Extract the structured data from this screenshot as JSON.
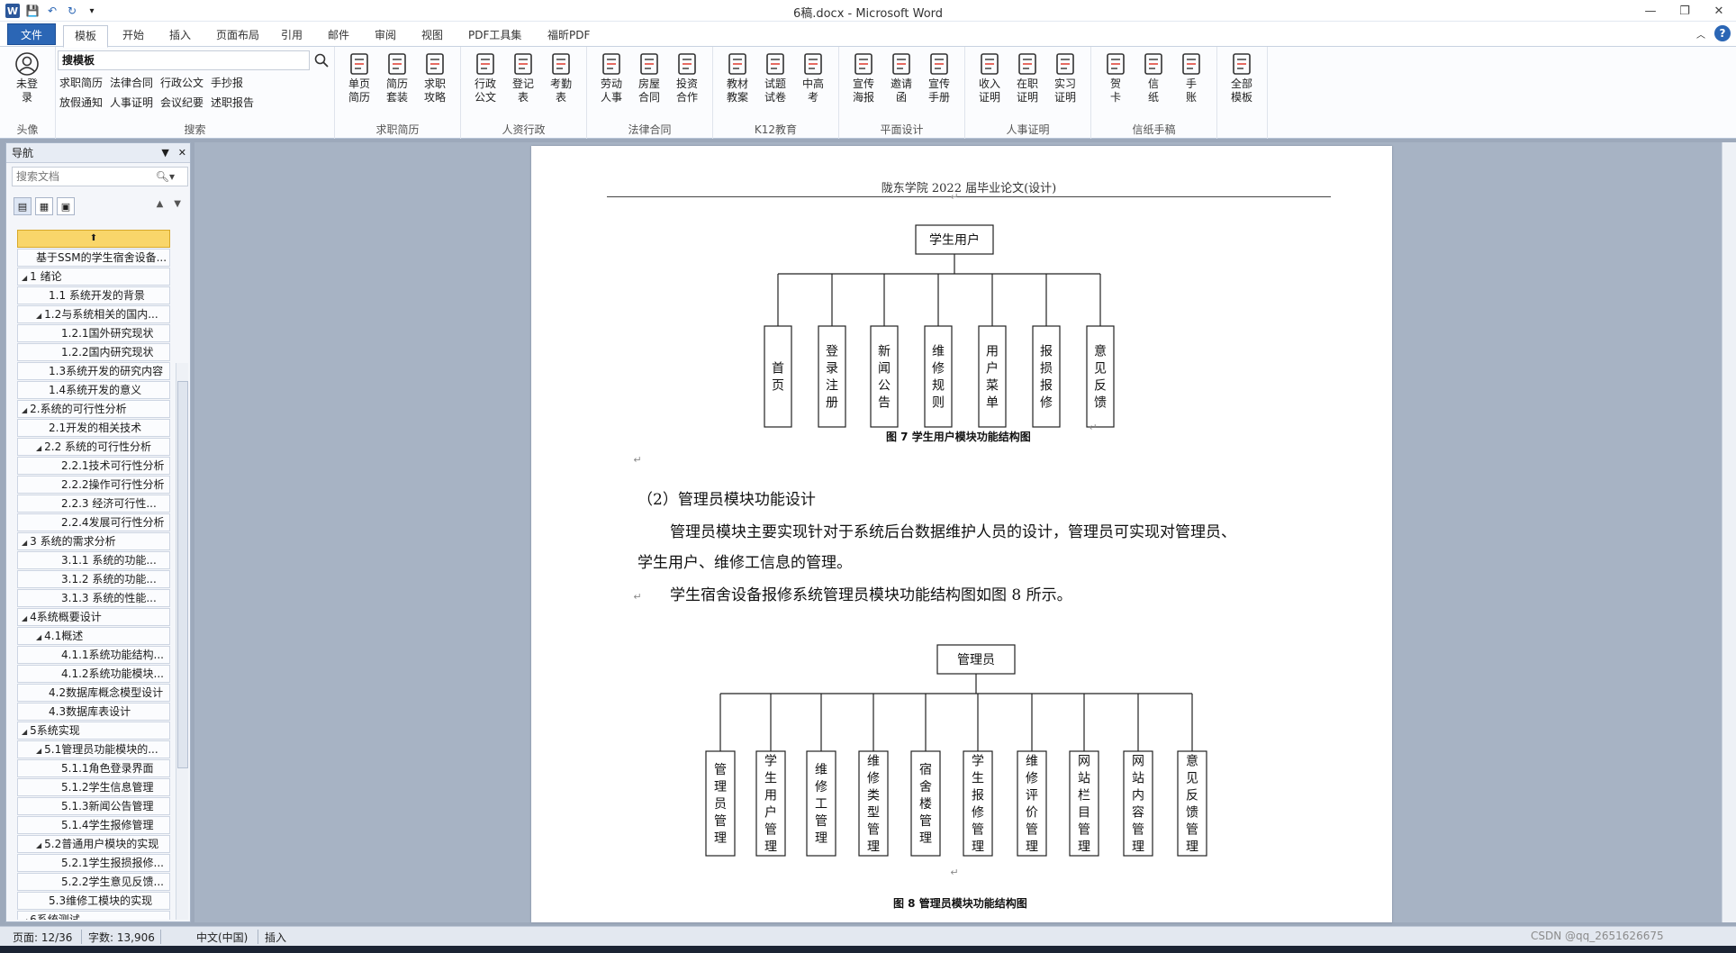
{
  "window": {
    "title": "6稿.docx - Microsoft Word",
    "controls": [
      "—",
      "❐",
      "✕"
    ]
  },
  "qat": {
    "logo": "W",
    "save": "💾",
    "undo": "↶",
    "redo": "↻",
    "more": "▾"
  },
  "tabs": [
    {
      "label": "文件"
    },
    {
      "label": "模板"
    },
    {
      "label": "开始"
    },
    {
      "label": "插入"
    },
    {
      "label": "页面布局"
    },
    {
      "label": "引用"
    },
    {
      "label": "邮件"
    },
    {
      "label": "审阅"
    },
    {
      "label": "视图"
    },
    {
      "label": "PDF工具集"
    },
    {
      "label": "福昕PDF"
    }
  ],
  "ribbon": {
    "avatar": {
      "label1": "未登",
      "label2": "录",
      "group": "头像"
    },
    "search": {
      "value": "搜模板",
      "links_row1": [
        "求职简历",
        "法律合同",
        "行政公文",
        "手抄报"
      ],
      "links_row2": [
        "放假通知",
        "人事证明",
        "会议纪要",
        "述职报告"
      ],
      "group": "搜索"
    },
    "groups": [
      {
        "name": "求职简历",
        "buttons": [
          [
            "单页",
            "简历"
          ],
          [
            "简历",
            "套装"
          ],
          [
            "求职",
            "攻略"
          ]
        ]
      },
      {
        "name": "人资行政",
        "buttons": [
          [
            "行政",
            "公文"
          ],
          [
            "登记",
            "表"
          ],
          [
            "考勤",
            "表"
          ]
        ]
      },
      {
        "name": "法律合同",
        "buttons": [
          [
            "劳动",
            "人事"
          ],
          [
            "房屋",
            "合同"
          ],
          [
            "投资",
            "合作"
          ]
        ]
      },
      {
        "name": "K12教育",
        "buttons": [
          [
            "教材",
            "教案"
          ],
          [
            "试题",
            "试卷"
          ],
          [
            "中高",
            "考"
          ]
        ]
      },
      {
        "name": "平面设计",
        "buttons": [
          [
            "宣传",
            "海报"
          ],
          [
            "邀请",
            "函"
          ],
          [
            "宣传",
            "手册"
          ]
        ]
      },
      {
        "name": "人事证明",
        "buttons": [
          [
            "收入",
            "证明"
          ],
          [
            "在职",
            "证明"
          ],
          [
            "实习",
            "证明"
          ]
        ]
      },
      {
        "name": "信纸手稿",
        "buttons": [
          [
            "贺",
            "卡"
          ],
          [
            "信",
            "纸"
          ],
          [
            "手",
            "账"
          ]
        ]
      },
      {
        "name": "",
        "buttons": [
          [
            "全部",
            "模板"
          ]
        ]
      }
    ]
  },
  "nav": {
    "title": "导航",
    "search_placeholder": "搜索文档",
    "items": [
      {
        "t": "基于SSM的学生宿舍设备...",
        "lv": 1,
        "tri": ""
      },
      {
        "t": "1 绪论",
        "lv": 0,
        "tri": "◢"
      },
      {
        "t": "1.1 系统开发的背景",
        "lv": 2,
        "tri": ""
      },
      {
        "t": "1.2与系统相关的国内...",
        "lv": 1,
        "tri": "◢"
      },
      {
        "t": "1.2.1国外研究现状",
        "lv": 3,
        "tri": ""
      },
      {
        "t": "1.2.2国内研究现状",
        "lv": 3,
        "tri": ""
      },
      {
        "t": "1.3系统开发的研究内容",
        "lv": 2,
        "tri": ""
      },
      {
        "t": "1.4系统开发的意义",
        "lv": 2,
        "tri": ""
      },
      {
        "t": "2.系统的可行性分析",
        "lv": 0,
        "tri": "◢"
      },
      {
        "t": "2.1开发的相关技术",
        "lv": 2,
        "tri": ""
      },
      {
        "t": "2.2 系统的可行性分析",
        "lv": 1,
        "tri": "◢"
      },
      {
        "t": "2.2.1技术可行性分析",
        "lv": 3,
        "tri": ""
      },
      {
        "t": "2.2.2操作可行性分析",
        "lv": 3,
        "tri": ""
      },
      {
        "t": "2.2.3 经济可行性...",
        "lv": 3,
        "tri": ""
      },
      {
        "t": "2.2.4发展可行性分析",
        "lv": 3,
        "tri": ""
      },
      {
        "t": "3 系统的需求分析",
        "lv": 0,
        "tri": "◢"
      },
      {
        "t": "3.1.1 系统的功能...",
        "lv": 3,
        "tri": ""
      },
      {
        "t": "3.1.2 系统的功能...",
        "lv": 3,
        "tri": ""
      },
      {
        "t": "3.1.3 系统的性能...",
        "lv": 3,
        "tri": ""
      },
      {
        "t": "4系统概要设计",
        "lv": 0,
        "tri": "◢"
      },
      {
        "t": "4.1概述",
        "lv": 1,
        "tri": "◢"
      },
      {
        "t": "4.1.1系统功能结构...",
        "lv": 3,
        "tri": ""
      },
      {
        "t": "4.1.2系统功能模块...",
        "lv": 3,
        "tri": ""
      },
      {
        "t": "4.2数据库概念模型设计",
        "lv": 2,
        "tri": ""
      },
      {
        "t": "4.3数据库表设计",
        "lv": 2,
        "tri": ""
      },
      {
        "t": "5系统实现",
        "lv": 0,
        "tri": "◢"
      },
      {
        "t": "5.1管理员功能模块的...",
        "lv": 1,
        "tri": "◢"
      },
      {
        "t": "5.1.1角色登录界面",
        "lv": 3,
        "tri": ""
      },
      {
        "t": "5.1.2学生信息管理",
        "lv": 3,
        "tri": ""
      },
      {
        "t": "5.1.3新闻公告管理",
        "lv": 3,
        "tri": ""
      },
      {
        "t": "5.1.4学生报修管理",
        "lv": 3,
        "tri": ""
      },
      {
        "t": "5.2普通用户模块的实现",
        "lv": 1,
        "tri": "◢"
      },
      {
        "t": "5.2.1学生报损报修...",
        "lv": 3,
        "tri": ""
      },
      {
        "t": "5.2.2学生意见反馈...",
        "lv": 3,
        "tri": ""
      },
      {
        "t": "5.3维修工模块的实现",
        "lv": 2,
        "tri": ""
      },
      {
        "t": "6系统测试",
        "lv": 0,
        "tri": "◢"
      }
    ]
  },
  "doc": {
    "header": "陇东学院 2022 届毕业论文(设计)",
    "fig7": {
      "root": "学生用户",
      "children": [
        "首页",
        "登录注册",
        "新闻公告",
        "维修规则",
        "用户菜单",
        "报损报修",
        "意见反馈"
      ],
      "caption": "图 7  学生用户模块功能结构图"
    },
    "section": "（2）管理员模块功能设计",
    "p1a": "管理员模块主要实现针对于系统后台数据维护人员的设计，管理员可实现对管理员、",
    "p1b": "学生用户、维修工信息的管理。",
    "p2": "学生宿舍设备报修系统管理员模块功能结构图如图 8 所示。",
    "fig8": {
      "root": "管理员",
      "children": [
        "管理员管理",
        "学生用户管理",
        "维修工管理",
        "维修类型管理",
        "宿舍楼管理",
        "学生报修管理",
        "维修评价管理",
        "网站栏目管理",
        "网站内容管理",
        "意见反馈管理"
      ],
      "caption": "图 8 管理员模块功能结构图"
    },
    "mark": "↵"
  },
  "status": {
    "page": "页面: 12/36",
    "words": "字数: 13,906",
    "lang": "中文(中国)",
    "mode": "插入",
    "watermark": "CSDN @qq_2651626675"
  }
}
